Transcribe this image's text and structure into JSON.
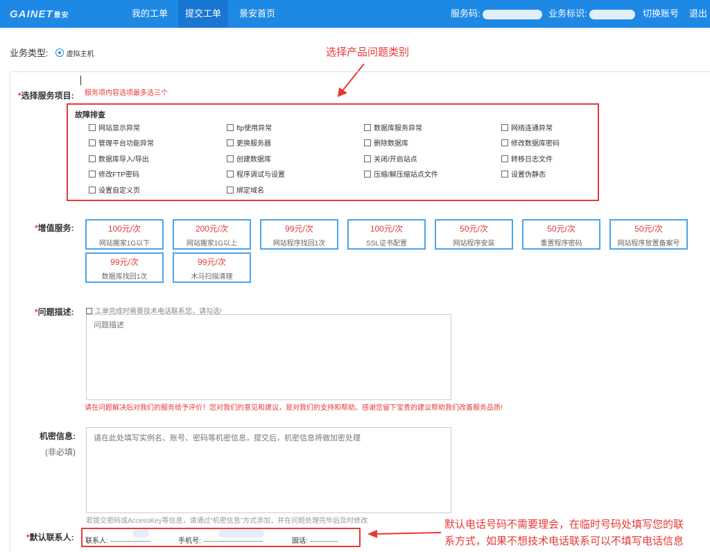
{
  "header": {
    "logo_text": "GAINET",
    "logo_cn": "景安",
    "nav": [
      {
        "label": "我的工单",
        "active": false
      },
      {
        "label": "提交工单",
        "active": true
      },
      {
        "label": "景安首页",
        "active": false
      }
    ],
    "service_code_label": "服务码:",
    "biz_id_label": "业务标识:",
    "switch_account": "切换账号",
    "logout": "退出"
  },
  "business_type": {
    "label": "业务类型:",
    "option": "虚拟主机"
  },
  "service_items": {
    "label": "选择服务项目:",
    "hint": "服务项内容选项最多选三个",
    "group_title": "故障排查",
    "options": [
      "网站显示异常",
      "ftp使用异常",
      "数据库服务异常",
      "网络连通异常",
      "管理平台功能异常",
      "更换服务器",
      "删除数据库",
      "修改数据库密码",
      "数据库导入/导出",
      "创建数据库",
      "关闭/开启站点",
      "转移日志文件",
      "修改FTP密码",
      "程序调试与设置",
      "压缩/解压缩站点文件",
      "设置伪静态",
      "设置自定义页",
      "绑定域名"
    ]
  },
  "value_added": {
    "label": "增值服务:",
    "items": [
      {
        "price": "100元/次",
        "name": "网站搬家1G以下"
      },
      {
        "price": "200元/次",
        "name": "网站搬家1G以上"
      },
      {
        "price": "99元/次",
        "name": "网站程序找回1次"
      },
      {
        "price": "100元/次",
        "name": "SSL证书配置"
      },
      {
        "price": "50元/次",
        "name": "网站程序安装"
      },
      {
        "price": "50元/次",
        "name": "重置程序密码"
      },
      {
        "price": "50元/次",
        "name": "网站程序放置备案号"
      },
      {
        "price": "99元/次",
        "name": "数据库找回1次"
      },
      {
        "price": "99元/次",
        "name": "木马扫描清理"
      }
    ]
  },
  "problem": {
    "label": "问题描述:",
    "phone_check": "工单完成时需要技术电话联系您，请勾选!",
    "placeholder": "问题描述",
    "feedback": "请在问题解决后对我们的服务给予评价！您对我们的意见和建议，是对我们的支持和帮助。感谢您留下宝贵的建议帮助我们改善服务品质!"
  },
  "secret": {
    "label": "机密信息:",
    "sub": "(非必填)",
    "placeholder": "请在此处填写实例名、账号、密码等机密信息，提交后，机密信息将做加密处理",
    "note": "若提交密码或AccessKey等信息，请通过“机密信息”方式添加，并在问题处理完毕后及时修改"
  },
  "contact": {
    "label": "默认联系人:",
    "name_label": "联系人:",
    "mobile_label": "手机号:",
    "phone_label": "固话:"
  },
  "annotations": {
    "top": "选择产品问题类别",
    "bottom_line1": "默认电话号码不需要理会，在临时号码处填写您的联",
    "bottom_line2": "系方式，如果不想技术电话联系可以不填写电话信息"
  },
  "colors": {
    "header_bg": "#1e88e5",
    "accent_red": "#e53935",
    "service_border": "#4da3e8"
  }
}
